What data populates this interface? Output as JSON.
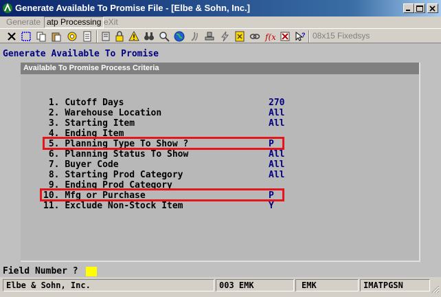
{
  "window": {
    "title": "Generate Available To Promise File - [Elbe & Sohn, Inc.]"
  },
  "menu": {
    "items": [
      {
        "label": "Generate",
        "state": "disabled"
      },
      {
        "label": "atp Processing",
        "state": "selected"
      },
      {
        "label": "eXit",
        "state": "disabled"
      }
    ]
  },
  "toolbar": {
    "icons": [
      "close-x-icon",
      "select-rect-icon",
      "copy-icon",
      "paste-icon",
      "gear-icon",
      "document-icon",
      "lock-icon",
      "warning-icon",
      "binoculars-icon",
      "magnifier-icon",
      "globe-icon",
      "script-icon",
      "stamp-icon",
      "lightning-icon",
      "calculator-icon",
      "link-icon",
      "function-icon",
      "exit-icon",
      "book-icon",
      "help-pointer-icon"
    ],
    "font_select": "08x15 Fixedsys"
  },
  "screen": {
    "heading": "Generate Available To Promise",
    "panel_title": "Available To Promise Process Criteria",
    "criteria": [
      {
        "number": " 1.",
        "label": "Cutoff Days",
        "value": "270"
      },
      {
        "number": " 2.",
        "label": "Warehouse Location",
        "value": "All"
      },
      {
        "number": " 3.",
        "label": "Starting Item",
        "value": "All"
      },
      {
        "number": " 4.",
        "label": "Ending Item",
        "value": ""
      },
      {
        "number": " 5.",
        "label": "Planning Type To Show ?",
        "value": "P"
      },
      {
        "number": " 6.",
        "label": "Planning Status To Show",
        "value": "All"
      },
      {
        "number": " 7.",
        "label": "Buyer Code",
        "value": "All"
      },
      {
        "number": " 8.",
        "label": "Starting Prod Category",
        "value": "All"
      },
      {
        "number": " 9.",
        "label": "Ending Prod Category",
        "value": ""
      },
      {
        "number": "10.",
        "label": "Mfg or Purchase",
        "value": "P"
      },
      {
        "number": "11.",
        "label": "Exclude Non-Stock Item",
        "value": "Y"
      }
    ],
    "highlight_color": "#e5161b",
    "field_prompt": "Field Number ?",
    "field_value": ""
  },
  "statusbar": {
    "company": "Elbe & Sohn, Inc.",
    "session": "003 EMK",
    "user": "EMK",
    "program": "IMATPGSN"
  }
}
